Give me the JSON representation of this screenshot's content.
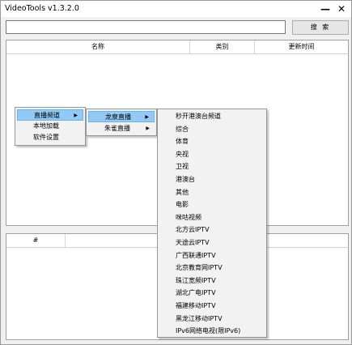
{
  "window": {
    "title": "VideoTools v1.3.2.0",
    "minimize": "—",
    "close": "✕"
  },
  "search": {
    "value": "",
    "placeholder": "",
    "button": "搜 索"
  },
  "table": {
    "columns": [
      "名称",
      "类别",
      "更新时间"
    ]
  },
  "bottom_table": {
    "columns": [
      "#"
    ]
  },
  "menu1": {
    "items": [
      {
        "label": "直播频道",
        "has_sub": true,
        "selected": true
      },
      {
        "label": "本地加载",
        "has_sub": false,
        "selected": false
      },
      {
        "label": "软件设置",
        "has_sub": false,
        "selected": false
      }
    ]
  },
  "menu2": {
    "items": [
      {
        "label": "龙泉直播",
        "has_sub": true,
        "selected": true
      },
      {
        "label": "朱雀直播",
        "has_sub": true,
        "selected": false
      }
    ]
  },
  "menu3": {
    "items": [
      "秒开港澳台频道",
      "综合",
      "体育",
      "央视",
      "卫视",
      "港澳台",
      "其他",
      "电影",
      "咪咕视频",
      "北方云IPTV",
      "天途云IPTV",
      "广西联通IPTV",
      "北京教育网IPTV",
      "珠江宽频IPTV",
      "湖北广电IPTV",
      "福建移动IPTV",
      "黑龙江移动IPTV",
      "IPv6网络电视(限IPv6)"
    ]
  }
}
